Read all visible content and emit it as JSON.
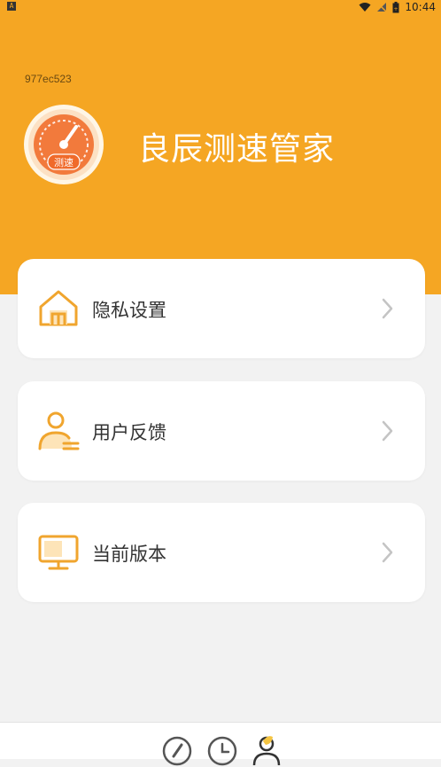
{
  "status_bar": {
    "left_badge": "A",
    "time": "10:44"
  },
  "header": {
    "device_id": "977ec523",
    "app_title": "良辰测速管家",
    "logo_badge": "测速"
  },
  "menu": [
    {
      "label": "隐私设置",
      "icon": "home-icon"
    },
    {
      "label": "用户反馈",
      "icon": "user-feedback-icon"
    },
    {
      "label": "当前版本",
      "icon": "monitor-icon"
    }
  ],
  "bottom_nav": [
    {
      "icon": "speedometer-icon"
    },
    {
      "icon": "clock-icon"
    },
    {
      "icon": "profile-icon",
      "active": true
    }
  ],
  "colors": {
    "accent": "#f5a623",
    "logo_orange": "#f27a3c",
    "background": "#f2f2f2"
  }
}
